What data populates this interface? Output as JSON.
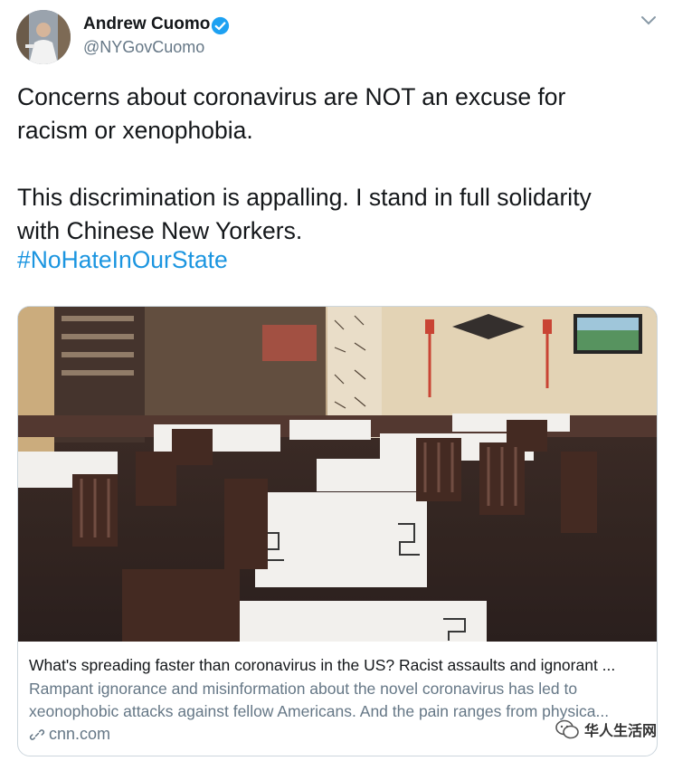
{
  "author": {
    "name": "Andrew Cuomo",
    "handle": "@NYGovCuomo",
    "verified": true
  },
  "tweet": {
    "text": "Concerns about coronavirus are NOT an excuse for\nracism or xenophobia.\n\nThis discrimination is appalling. I stand in full solidarity\nwith Chinese New Yorkers.",
    "hashtag": "#NoHateInOurState"
  },
  "card": {
    "image_icon": "restaurant-photo",
    "title": "What's spreading faster than coronavirus in the US? Racist assaults and ignorant ...",
    "description": "Rampant ignorance and misinformation about the novel coronavirus has led to xeonophobic attacks against fellow Americans. And the pain ranges from physica...",
    "domain": "cnn.com"
  },
  "watermark": {
    "text": "华人生活网"
  },
  "colors": {
    "accent": "#1b95e0",
    "secondary_text": "#657786",
    "border": "#ccd6dd"
  }
}
